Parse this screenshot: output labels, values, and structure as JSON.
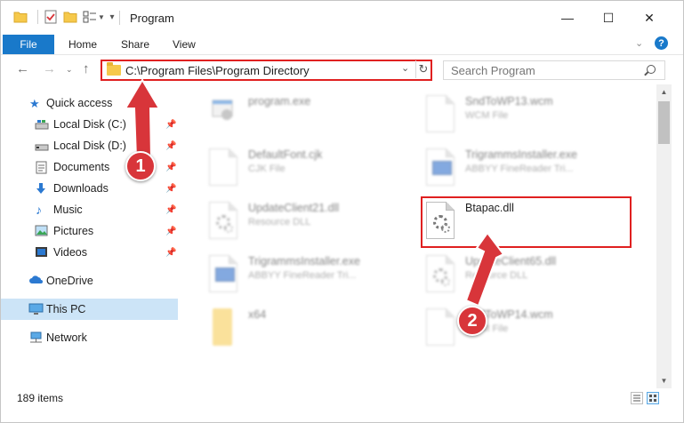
{
  "window": {
    "title": "Program",
    "controls": {
      "minimize": "—",
      "maximize": "☐",
      "close": "✕"
    }
  },
  "ribbon": {
    "tabs": [
      {
        "label": "File",
        "active": true
      },
      {
        "label": "Home"
      },
      {
        "label": "Share"
      },
      {
        "label": "View"
      }
    ],
    "help_label": "?"
  },
  "address_bar": {
    "path": "C:\\Program Files\\Program Directory"
  },
  "search": {
    "placeholder": "Search Program"
  },
  "sidebar": {
    "quick_access": "Quick access",
    "items": [
      {
        "label": "Local Disk (C:)",
        "icon": "drive-icon",
        "pinned": true
      },
      {
        "label": "Local Disk (D:)",
        "icon": "drive-icon",
        "pinned": true
      },
      {
        "label": "Documents",
        "icon": "documents-icon",
        "pinned": true
      },
      {
        "label": "Downloads",
        "icon": "downloads-icon",
        "pinned": true
      },
      {
        "label": "Music",
        "icon": "music-icon",
        "pinned": true
      },
      {
        "label": "Pictures",
        "icon": "pictures-icon",
        "pinned": true
      },
      {
        "label": "Videos",
        "icon": "videos-icon",
        "pinned": true
      }
    ],
    "onedrive": "OneDrive",
    "this_pc": "This PC",
    "network": "Network"
  },
  "files": [
    {
      "name": "program.exe",
      "type": "",
      "icon": "exe-icon"
    },
    {
      "name": "SndToWP13.wcm",
      "type": "WCM File",
      "icon": "document-icon"
    },
    {
      "name": "DefaultFont.cjk",
      "type": "CJK File",
      "icon": "document-icon"
    },
    {
      "name": "TrigrammsInstaller.exe",
      "type": "ABBYY FineReader Tri...",
      "icon": "app-icon"
    },
    {
      "name": "UpdateClient21.dll",
      "type": "Resource DLL",
      "icon": "dll-icon"
    },
    {
      "name": "Btapac.dll",
      "type": "",
      "icon": "dll-icon",
      "highlighted": true
    },
    {
      "name": "TrigrammsInstaller.exe",
      "type": "ABBYY FineReader Tri...",
      "icon": "app-icon"
    },
    {
      "name": "UpdateClient65.dll",
      "type": "Resource DLL",
      "icon": "dll-icon"
    },
    {
      "name": "x64",
      "type": "",
      "icon": "folder-icon"
    },
    {
      "name": "SndToWP14.wcm",
      "type": "WCM File",
      "icon": "document-icon"
    }
  ],
  "status": {
    "item_count": "189 items"
  },
  "annotations": {
    "step1": "1",
    "step2": "2",
    "color": "#d8353a"
  }
}
